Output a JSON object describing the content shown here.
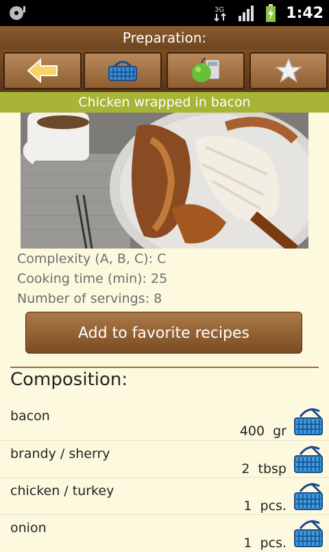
{
  "status_bar": {
    "network_label": "3G",
    "time": "1:42"
  },
  "header": {
    "title": "Preparation:"
  },
  "toolbar": {
    "buttons": [
      {
        "icon": "back-arrow-icon"
      },
      {
        "icon": "basket-icon"
      },
      {
        "icon": "apple-calculator-icon"
      },
      {
        "icon": "star-icon"
      }
    ]
  },
  "recipe": {
    "title": "Chicken wrapped in bacon",
    "complexity": "Complexity (A, B, C): C",
    "cooking_time": "Cooking time (min): 25",
    "servings": "Number of servings: 8",
    "favorite_button": "Add to favorite recipes"
  },
  "composition": {
    "title": "Composition:",
    "items": [
      {
        "name": "bacon",
        "qty": "400  gr"
      },
      {
        "name": "brandy / sherry",
        "qty": "2  tbsp"
      },
      {
        "name": "chicken / turkey",
        "qty": "1  pcs."
      },
      {
        "name": "onion",
        "qty": "1  pcs."
      }
    ]
  },
  "colors": {
    "header_brown": "#8a5a2c",
    "title_green": "#a7b436",
    "background": "#fdf9df",
    "info_gray": "#6d6d6d"
  }
}
